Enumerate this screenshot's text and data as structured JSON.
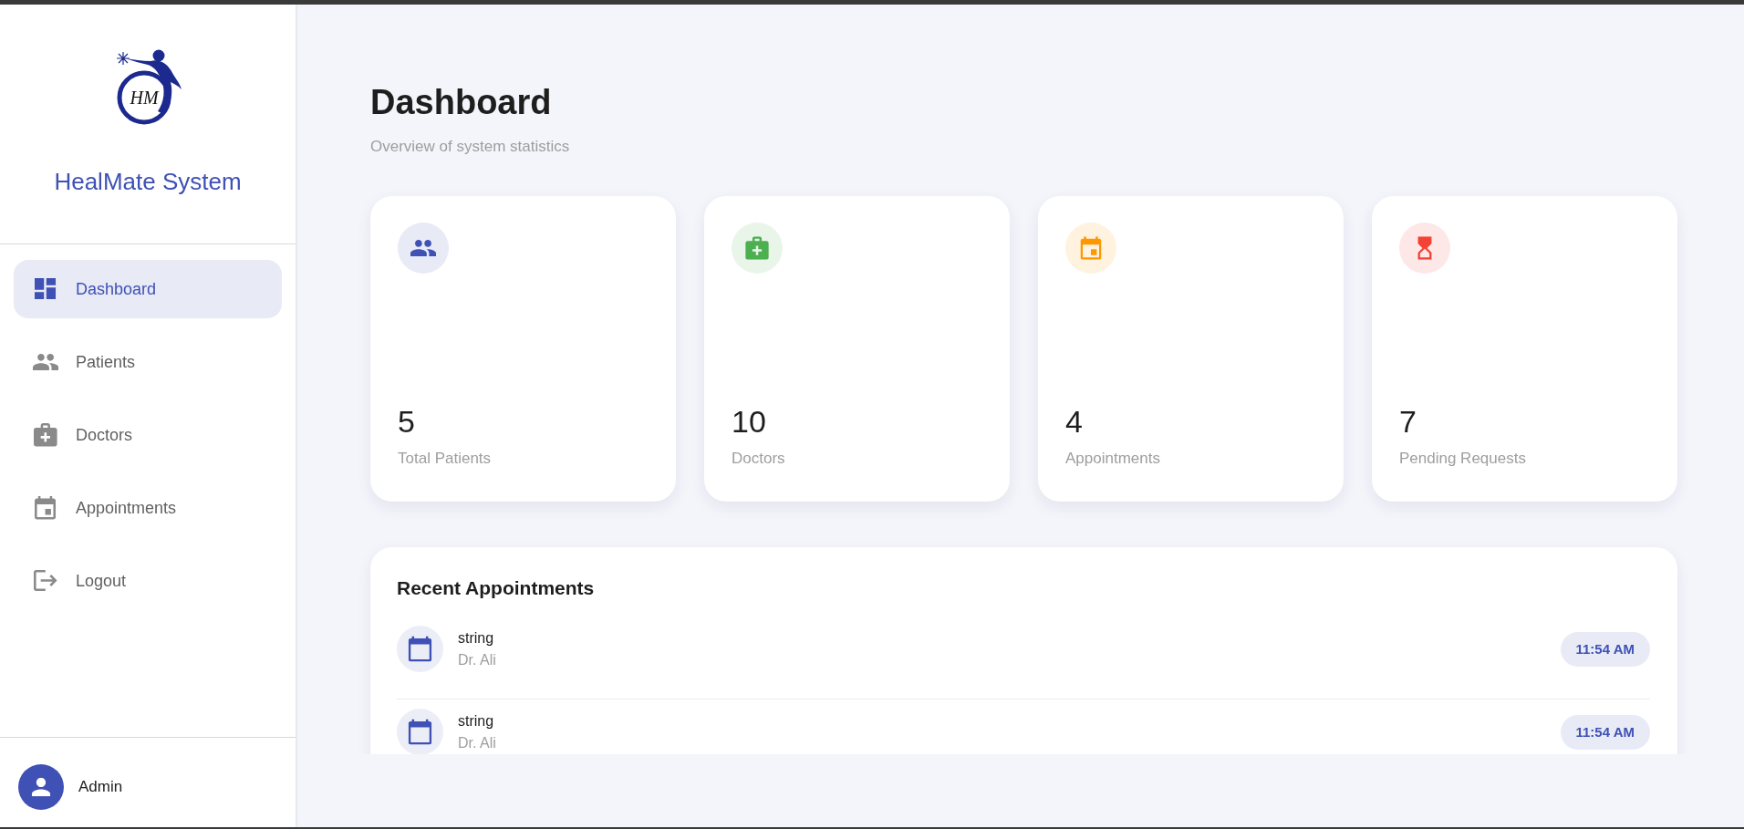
{
  "sidebar": {
    "logo": {
      "monogram": "HM"
    },
    "title": "HealMate System",
    "items": [
      {
        "label": "Dashboard",
        "selected": true
      },
      {
        "label": "Patients",
        "selected": false
      },
      {
        "label": "Doctors",
        "selected": false
      },
      {
        "label": "Appointments",
        "selected": false
      },
      {
        "label": "Logout",
        "selected": false
      }
    ],
    "user": {
      "name": "Admin"
    }
  },
  "header": {
    "title": "Dashboard",
    "subtitle": "Overview of system statistics"
  },
  "stats": [
    {
      "value": "5",
      "label": "Total Patients",
      "color": "#3f51b5"
    },
    {
      "value": "10",
      "label": "Doctors",
      "color": "#4caf50"
    },
    {
      "value": "4",
      "label": "Appointments",
      "color": "#ff9800"
    },
    {
      "value": "7",
      "label": "Pending Requests",
      "color": "#f44336"
    }
  ],
  "recent_appointments": {
    "title": "Recent Appointments",
    "items": [
      {
        "title": "string",
        "doctor": "Dr. Ali",
        "time": "11:54 AM"
      },
      {
        "title": "string",
        "doctor": "Dr. Ali",
        "time": "11:54 AM"
      }
    ]
  }
}
